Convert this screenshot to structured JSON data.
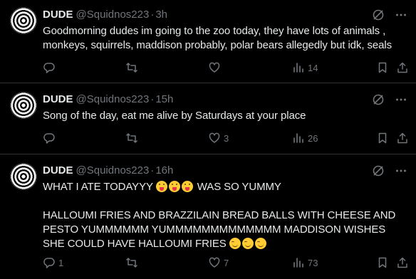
{
  "tweets": [
    {
      "name": "DUDE",
      "handle": "@Squidnos223",
      "separator": "·",
      "time": "3h",
      "text": "Goodmorning dudes im going to the zoo today, they have lots of animals , monkeys, squirrels, maddison probably, polar bears allegedly but idk, seals",
      "reply_count": "",
      "retweet_count": "",
      "like_count": "",
      "view_count": "14"
    },
    {
      "name": "DUDE",
      "handle": "@Squidnos223",
      "separator": "·",
      "time": "15h",
      "text": "Song of the day, eat me alive by Saturdays at your place",
      "reply_count": "",
      "retweet_count": "",
      "like_count": "3",
      "view_count": "26"
    },
    {
      "name": "DUDE",
      "handle": "@Squidnos223",
      "separator": "·",
      "time": "16h",
      "text_line1": "WHAT I ATE TODAYYY",
      "text_line1_tail": " WAS SO YUMMY",
      "text_body": "HALLOUMI FRIES AND BRAZZILAIN BREAD BALLS WITH CHEESE AND PESTO YUMMMMMM YUMMMMMMMMMMMMM MADDISON WISHES SHE COULD HAVE HALLOUMI FRIES",
      "reply_count": "1",
      "retweet_count": "",
      "like_count": "7",
      "view_count": "73"
    }
  ],
  "icons": {
    "grok": "grok-icon",
    "more": "more-icon",
    "reply": "reply-icon",
    "retweet": "retweet-icon",
    "like": "heart-icon",
    "views": "views-icon",
    "bookmark": "bookmark-icon",
    "share": "share-icon"
  },
  "colors": {
    "background": "#000000",
    "text": "#e7e9ea",
    "muted": "#71767b",
    "divider": "#2f3336"
  }
}
